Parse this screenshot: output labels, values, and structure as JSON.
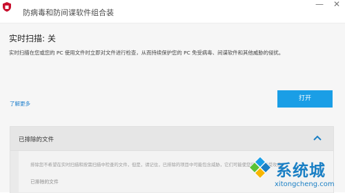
{
  "app": {
    "title": "防病毒和防间谍软件组合装",
    "logo_icon": "shield-logo-icon",
    "minimize_label": "—",
    "close_label": "✕"
  },
  "realtime_scan": {
    "title": "实时扫描: 关",
    "description": "实时扫描在您或您的 PC 使用文件时立即对文件进行检查，从而持续保护您的 PC 免受病毒、间谍软件和其他威胁的侵扰。",
    "learn_more": "了解更多",
    "open_button": "打开"
  },
  "excluded_files": {
    "header": "已排除的文件",
    "description": "排除您不希望在实时扫描和按需扫描中检查的文件，但是，请记住，已排除的项目中可能包含威胁，它们可能使您的 PC 易受攻击。",
    "label": "已排除的文件"
  },
  "watermark": {
    "brand": "系统城",
    "url": "xitongcheng.com"
  },
  "colors": {
    "accent": "#1a9ee6",
    "link": "#1f7fcc",
    "brand_red": "#c8102e",
    "watermark_blue": "#1a7fc4"
  }
}
